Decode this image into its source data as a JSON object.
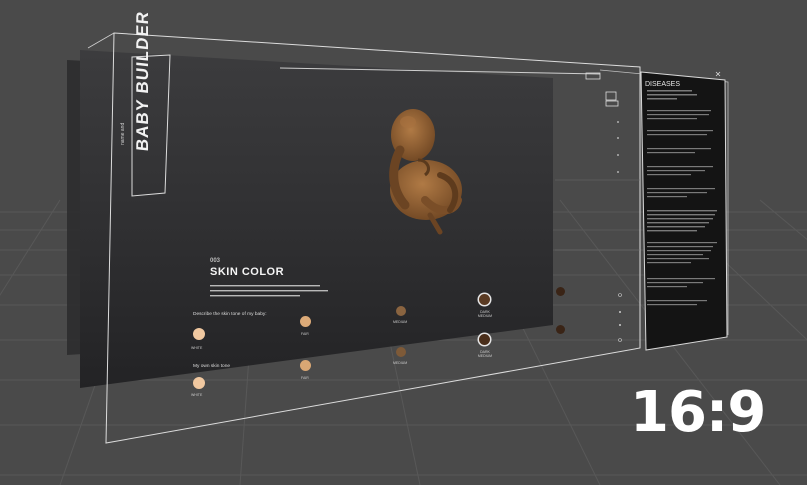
{
  "app": {
    "subtitle": "name and",
    "title": "BABY BUILDER"
  },
  "section": {
    "step": "003",
    "title": "SKIN COLOR"
  },
  "questions": [
    {
      "label": "Describe the skin tone of my baby:"
    },
    {
      "label": "My own skin tone"
    }
  ],
  "swatches": {
    "row1": [
      {
        "label": "WHITE",
        "color": "#f0c8a0"
      },
      {
        "label": "FAIR",
        "color": "#dcaa78"
      },
      {
        "label": "MEDIUM",
        "color": "#8a6440"
      },
      {
        "label": "DARK MEDIUM",
        "color": "#5a3a22"
      },
      {
        "label": "",
        "color": "#3a2416"
      }
    ],
    "row2": [
      {
        "label": "WHITE",
        "color": "#f0c8a0"
      },
      {
        "label": "FAIR",
        "color": "#d9a774"
      },
      {
        "label": "MEDIUM",
        "color": "#7e5a38"
      },
      {
        "label": "DARK MEDIUM",
        "color": "#4a2e1a"
      },
      {
        "label": "",
        "color": "#3a2416"
      }
    ]
  },
  "panel": {
    "title": "DISEASES"
  },
  "badge": "16:9",
  "colors": {
    "background": "#4a4a4a",
    "screen": "#2e2e30",
    "panel": "#121212",
    "accent": "#ffffff",
    "baby_skin": "#8a5a2b"
  }
}
